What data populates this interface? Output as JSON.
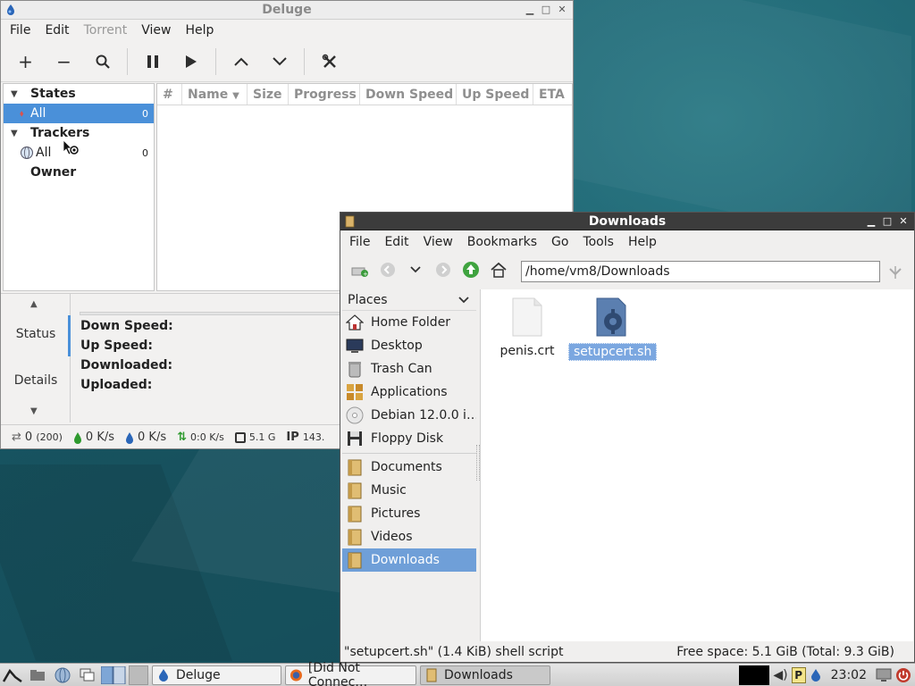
{
  "desktop": {},
  "deluge": {
    "title": "Deluge",
    "menu": [
      "File",
      "Edit",
      "Torrent",
      "View",
      "Help"
    ],
    "toolbar": {
      "add": "+",
      "remove": "−",
      "search": "⚲",
      "pause": "❚❚",
      "resume": "▶",
      "up": "∧",
      "down": "∨",
      "prefs": "✂"
    },
    "sidebar": {
      "states_label": "States",
      "states_all_label": "All",
      "states_all_count": "0",
      "trackers_label": "Trackers",
      "trackers_all_label": "All",
      "trackers_all_count": "0",
      "owner_label": "Owner"
    },
    "columns": [
      "#",
      "Name",
      "Size",
      "Progress",
      "Down Speed",
      "Up Speed",
      "ETA"
    ],
    "details": {
      "tab_status": "Status",
      "tab_details": "Details",
      "down_speed_label": "Down Speed:",
      "up_speed_label": "Up Speed:",
      "downloaded_label": "Downloaded:",
      "uploaded_label": "Uploaded:"
    },
    "statusbar": {
      "connections": "0",
      "connections_max": "(200)",
      "download": "0 K/s",
      "upload": "0 K/s",
      "protocol": "0:0 K/s",
      "free_space": "5.1 G",
      "ip_label": "IP",
      "ip_value": "143."
    }
  },
  "filemanager": {
    "title": "Downloads",
    "menu": [
      "File",
      "Edit",
      "View",
      "Bookmarks",
      "Go",
      "Tools",
      "Help"
    ],
    "location": "/home/vm8/Downloads",
    "places_label": "Places",
    "places": [
      "Home Folder",
      "Desktop",
      "Trash Can",
      "Applications",
      "Debian 12.0.0 i…",
      "Floppy Disk"
    ],
    "bookmarks": [
      "Documents",
      "Music",
      "Pictures",
      "Videos",
      "Downloads"
    ],
    "files": [
      {
        "name": "penis.crt"
      },
      {
        "name": "setupcert.sh"
      }
    ],
    "status_left": "\"setupcert.sh\" (1.4 KiB) shell script",
    "status_right": "Free space: 5.1 GiB (Total: 9.3 GiB)"
  },
  "taskbar": {
    "tasks": [
      "Deluge",
      "[Did Not Connec…",
      "Downloads"
    ],
    "tray_p": "P",
    "clock": "23:02"
  },
  "colors": {
    "selection": "#4a90d9",
    "fm_title_bg": "#3c3c3c",
    "desktop_bg": "#1d5a66"
  }
}
